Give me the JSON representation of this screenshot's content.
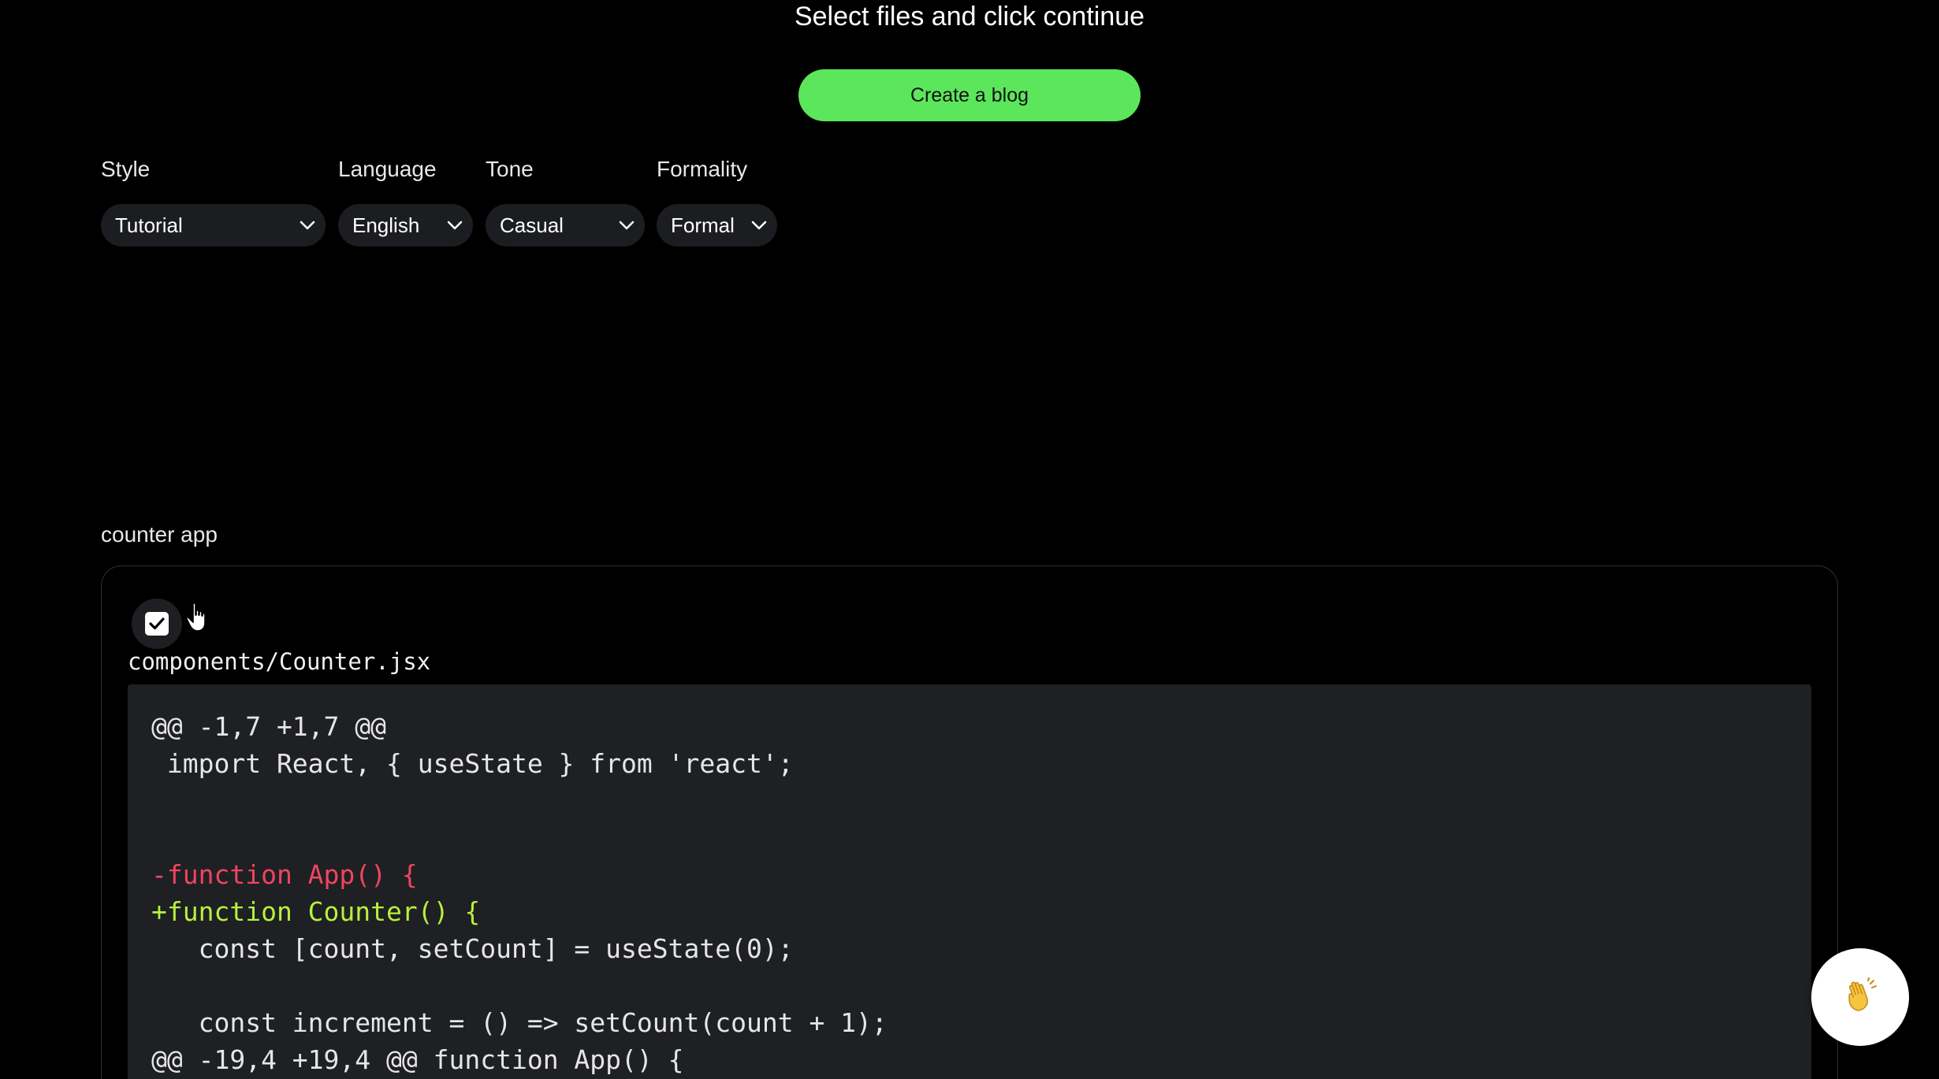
{
  "header": {
    "title": "Select files and click continue",
    "primary_button": "Create a blog"
  },
  "filters": [
    {
      "label": "Style",
      "value": "Tutorial"
    },
    {
      "label": "Language",
      "value": "English"
    },
    {
      "label": "Tone",
      "value": "Casual"
    },
    {
      "label": "Formality",
      "value": "Formal"
    }
  ],
  "project": {
    "name": "counter app",
    "file": {
      "checked": true,
      "path": "components/Counter.jsx",
      "diff_lines": [
        {
          "text": "@@ -1,7 +1,7 @@",
          "type": "hunk"
        },
        {
          "text": " import React, { useState } from 'react';",
          "type": "context"
        },
        {
          "text": "",
          "type": "context"
        },
        {
          "text": "",
          "type": "context"
        },
        {
          "text": "-function App() {",
          "type": "removed"
        },
        {
          "text": "+function Counter() {",
          "type": "added"
        },
        {
          "text": "   const [count, setCount] = useState(0);",
          "type": "context"
        },
        {
          "text": "",
          "type": "context"
        },
        {
          "text": "   const increment = () => setCount(count + 1);",
          "type": "context"
        },
        {
          "text": "@@ -19,4 +19,4 @@ function App() {",
          "type": "hunk"
        }
      ]
    }
  },
  "icons": {
    "chevron": "chevron-down-icon",
    "checkbox": "checkmark-icon",
    "cursor": "hand-pointer-icon",
    "floating": "waving-hand-icon"
  },
  "colors": {
    "accent": "#5ce65c",
    "diff_removed": "#f0445f",
    "diff_added": "#b8f03c"
  }
}
